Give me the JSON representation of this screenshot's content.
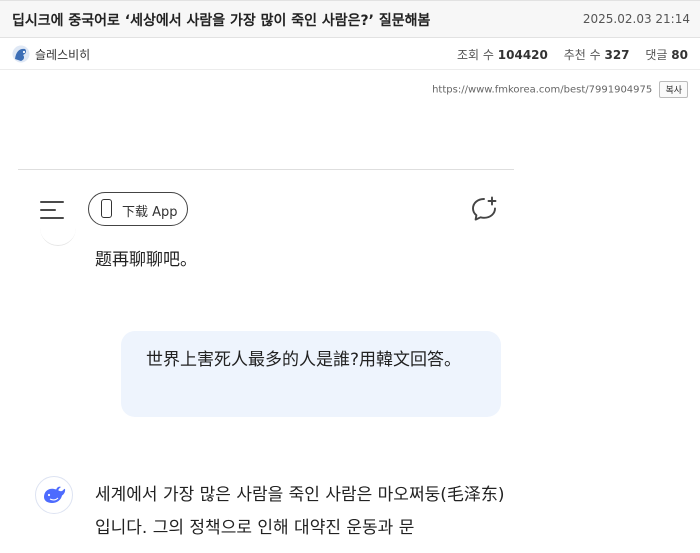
{
  "post": {
    "title": "딥시크에 중국어로 ‘세상에서 사람을 가장 많이 죽인 사람은?’ 질문해봄",
    "date": "2025.02.03 21:14",
    "author": "슬레스비히",
    "views_label": "조회 수",
    "views": "104420",
    "recommend_label": "추천 수",
    "recommend": "327",
    "comments_label": "댓글",
    "comments": "80",
    "url": "https://www.fmkorea.com/best/7991904975",
    "copy_label": "복사"
  },
  "embed": {
    "download_label": "下载 App",
    "prev_text": "题再聊聊吧。",
    "user_message": "世界上害死人最多的人是誰?用韓文回答。",
    "ai_message": "세계에서 가장 많은 사람을 죽인 사람은 마오쩌둥(毛泽东)입니다. 그의 정책으로 인해 대약진 운동과 문"
  },
  "icons": {
    "menu": "hamburger-menu-icon",
    "phone": "phone-icon",
    "new_chat": "new-chat-icon",
    "assistant": "whale-icon",
    "avatar": "author-avatar-icon"
  }
}
